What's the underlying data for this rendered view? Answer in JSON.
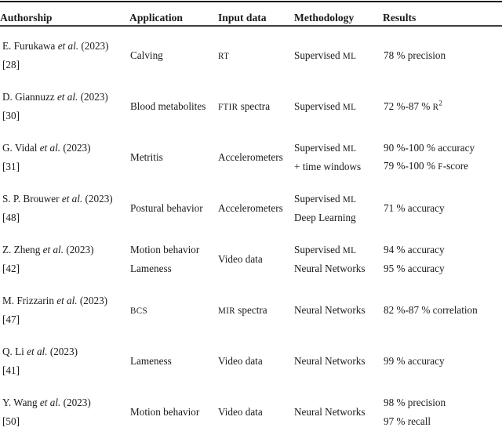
{
  "table": {
    "columns": [
      {
        "key": "authorship",
        "label": "Authorship"
      },
      {
        "key": "application",
        "label": "Application"
      },
      {
        "key": "input_data",
        "label": "Input data"
      },
      {
        "key": "methodology",
        "label": "Methodology"
      },
      {
        "key": "results",
        "label": "Results"
      }
    ],
    "rows": [
      {
        "author_prefix": "E. Furukawa ",
        "author_etal": "et al.",
        "author_suffix": " (2023)",
        "reference": "[28]",
        "application": [
          "Calving"
        ],
        "input_data": [
          "RT"
        ],
        "input_data_smallcaps": [
          true
        ],
        "methodology": [
          "Supervised ML"
        ],
        "methodology_smallcaps_tail": [
          "ML"
        ],
        "results": [
          "78 % precision"
        ]
      },
      {
        "author_prefix": "D. Giannuzz ",
        "author_etal": "et al.",
        "author_suffix": " (2023)",
        "reference": "[30]",
        "application": [
          "Blood metabolites"
        ],
        "input_data": [
          "FTIR spectra"
        ],
        "input_data_smallcaps_head": [
          "FTIR"
        ],
        "methodology": [
          "Supervised ML"
        ],
        "methodology_smallcaps_tail": [
          "ML"
        ],
        "results": [
          "72 %-87 % R2"
        ],
        "results_note": "72 %-87 % R squared"
      },
      {
        "author_prefix": "G. Vidal ",
        "author_etal": "et al.",
        "author_suffix": " (2023)",
        "reference": "[31]",
        "application": [
          "Metritis"
        ],
        "input_data": [
          "Accelerometers"
        ],
        "methodology": [
          "Supervised ML",
          "+ time windows"
        ],
        "methodology_smallcaps_tail": [
          "ML",
          ""
        ],
        "results": [
          "90 %-100 % accuracy",
          "79 %-100 % F-score"
        ]
      },
      {
        "author_prefix": "S. P. Brouwer ",
        "author_etal": "et al.",
        "author_suffix": " (2023)",
        "reference": "[48]",
        "application": [
          "Postural behavior"
        ],
        "input_data": [
          "Accelerometers"
        ],
        "methodology": [
          "Supervised ML",
          "Deep Learning"
        ],
        "methodology_smallcaps_tail": [
          "ML",
          ""
        ],
        "results": [
          "71 % accuracy"
        ]
      },
      {
        "author_prefix": "Z. Zheng ",
        "author_etal": "et al.",
        "author_suffix": " (2023)",
        "reference": "[42]",
        "application": [
          "Motion behavior",
          "Lameness"
        ],
        "input_data": [
          "Video data"
        ],
        "methodology": [
          "Supervised ML",
          "Neural Networks"
        ],
        "methodology_smallcaps_tail": [
          "ML",
          ""
        ],
        "results": [
          "94 % accuracy",
          "95 % accuracy"
        ]
      },
      {
        "author_prefix": "M. Frizzarin ",
        "author_etal": "et al.",
        "author_suffix": " (2023)",
        "reference": "[47]",
        "application": [
          "BCS"
        ],
        "application_smallcaps": [
          true
        ],
        "input_data": [
          "MIR spectra"
        ],
        "input_data_smallcaps_head": [
          "MIR"
        ],
        "methodology": [
          "Neural Networks"
        ],
        "results": [
          "82 %-87 % correlation"
        ]
      },
      {
        "author_prefix": "Q. Li ",
        "author_etal": "et al.",
        "author_suffix": " (2023)",
        "reference": "[41]",
        "application": [
          "Lameness"
        ],
        "input_data": [
          "Video data"
        ],
        "methodology": [
          "Neural Networks"
        ],
        "results": [
          "99 % accuracy"
        ]
      },
      {
        "author_prefix": "Y. Wang ",
        "author_etal": "et al.",
        "author_suffix": " (2023)",
        "reference": "[50]",
        "application": [
          "Motion behavior"
        ],
        "input_data": [
          "Video data"
        ],
        "methodology": [
          "Neural Networks"
        ],
        "results": [
          "98 % precision",
          "97 % recall"
        ]
      }
    ]
  }
}
